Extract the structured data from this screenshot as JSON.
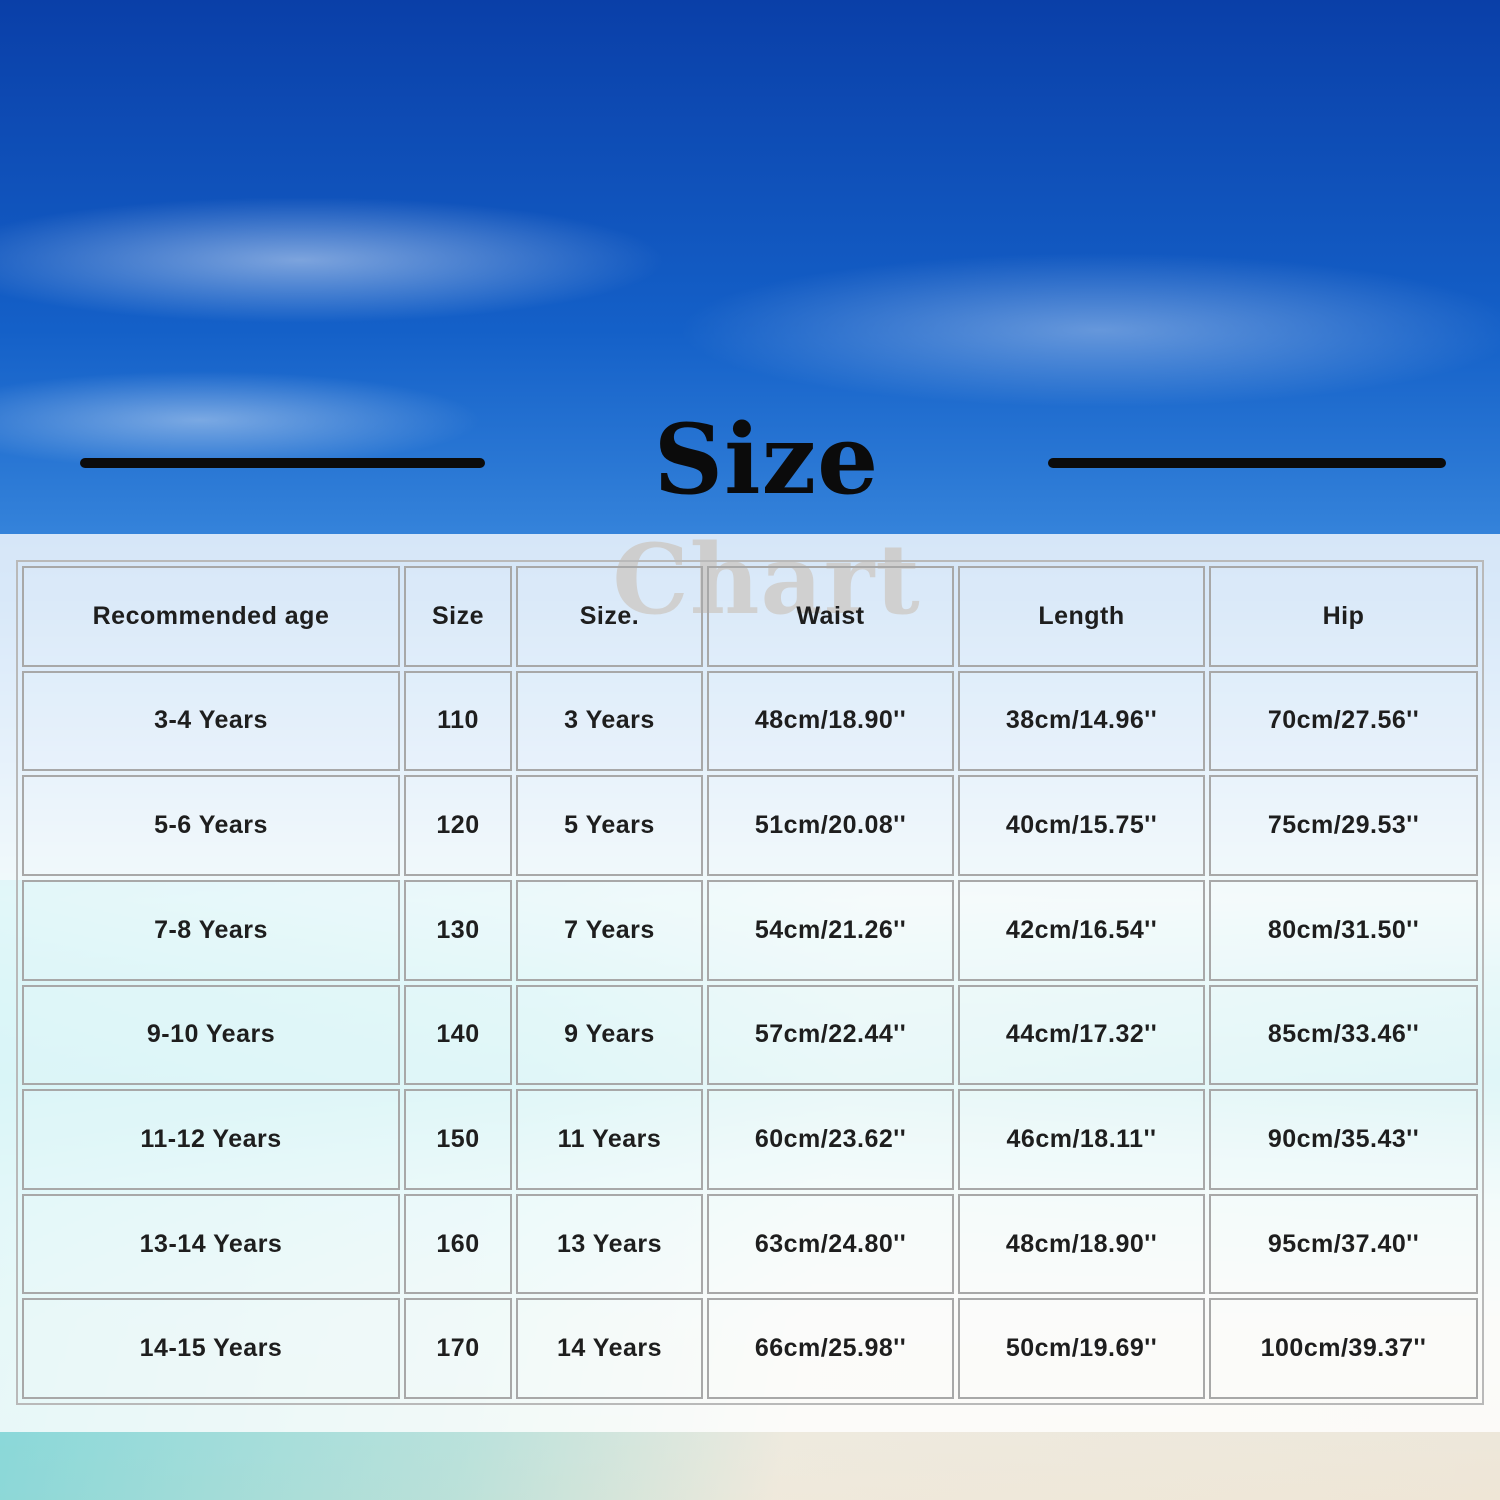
{
  "title": "Size Chart",
  "headers": [
    "Recommended age",
    "Size",
    "Size.",
    "Waist",
    "Length",
    "Hip"
  ],
  "rows": [
    [
      "3-4 Years",
      "110",
      "3 Years",
      "48cm/18.90''",
      "38cm/14.96''",
      "70cm/27.56''"
    ],
    [
      "5-6 Years",
      "120",
      "5 Years",
      "51cm/20.08''",
      "40cm/15.75''",
      "75cm/29.53''"
    ],
    [
      "7-8 Years",
      "130",
      "7 Years",
      "54cm/21.26''",
      "42cm/16.54''",
      "80cm/31.50''"
    ],
    [
      "9-10 Years",
      "140",
      "9 Years",
      "57cm/22.44''",
      "44cm/17.32''",
      "85cm/33.46''"
    ],
    [
      "11-12 Years",
      "150",
      "11 Years",
      "60cm/23.62''",
      "46cm/18.11''",
      "90cm/35.43''"
    ],
    [
      "13-14 Years",
      "160",
      "13 Years",
      "63cm/24.80''",
      "48cm/18.90''",
      "95cm/37.40''"
    ],
    [
      "14-15 Years",
      "170",
      "14 Years",
      "66cm/25.98''",
      "50cm/19.69''",
      "100cm/39.37''"
    ]
  ]
}
